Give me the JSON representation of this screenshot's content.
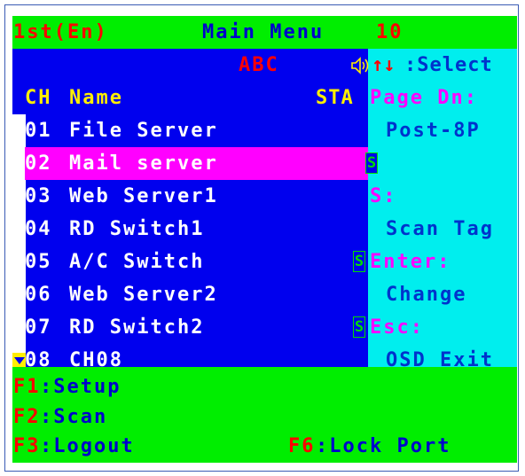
{
  "header": {
    "profile": "1st(En)",
    "title": "Main Menu",
    "page": "10"
  },
  "toolbar": {
    "search_text": "ABC",
    "speaker_icon": "speaker-icon",
    "updown_icon": "↑↓"
  },
  "columns": {
    "ch": "CH",
    "name": "Name",
    "sta": "STA"
  },
  "rows": [
    {
      "ch": "01",
      "name": "File Server",
      "scan": false
    },
    {
      "ch": "02",
      "name": "Mail server",
      "scan": true,
      "selected": true
    },
    {
      "ch": "03",
      "name": "Web Server1",
      "scan": false
    },
    {
      "ch": "04",
      "name": "RD Switch1",
      "scan": false
    },
    {
      "ch": "05",
      "name": "A/C Switch",
      "scan": true
    },
    {
      "ch": "06",
      "name": "Web Server2",
      "scan": false
    },
    {
      "ch": "07",
      "name": "RD Switch2",
      "scan": true
    },
    {
      "ch": "08",
      "name": "CH08",
      "scan": false
    }
  ],
  "scan_badge": "S",
  "help": {
    "select": ":Select",
    "pagedn_key": "Page Dn:",
    "pagedn_val": "Post-8P",
    "s_key": "S:",
    "s_val": "Scan Tag",
    "enter_key": "Enter:",
    "enter_val": "Change",
    "esc_key": "Esc:",
    "esc_val": "OSD Exit"
  },
  "footer": {
    "f1_key": "F1",
    "f1_label": ":Setup",
    "f2_key": "F2",
    "f2_label": ":Scan",
    "f3_key": "F3",
    "f3_label": ":Logout",
    "f6_key": "F6",
    "f6_label": ":Lock Port"
  },
  "colors": {
    "osd_green": "#00ee00",
    "list_blue": "#0000ee",
    "help_cyan": "#00eeee",
    "selection": "#ff00ff",
    "hotkey_red": "#ff0000",
    "header_yellow": "#ffee00"
  }
}
